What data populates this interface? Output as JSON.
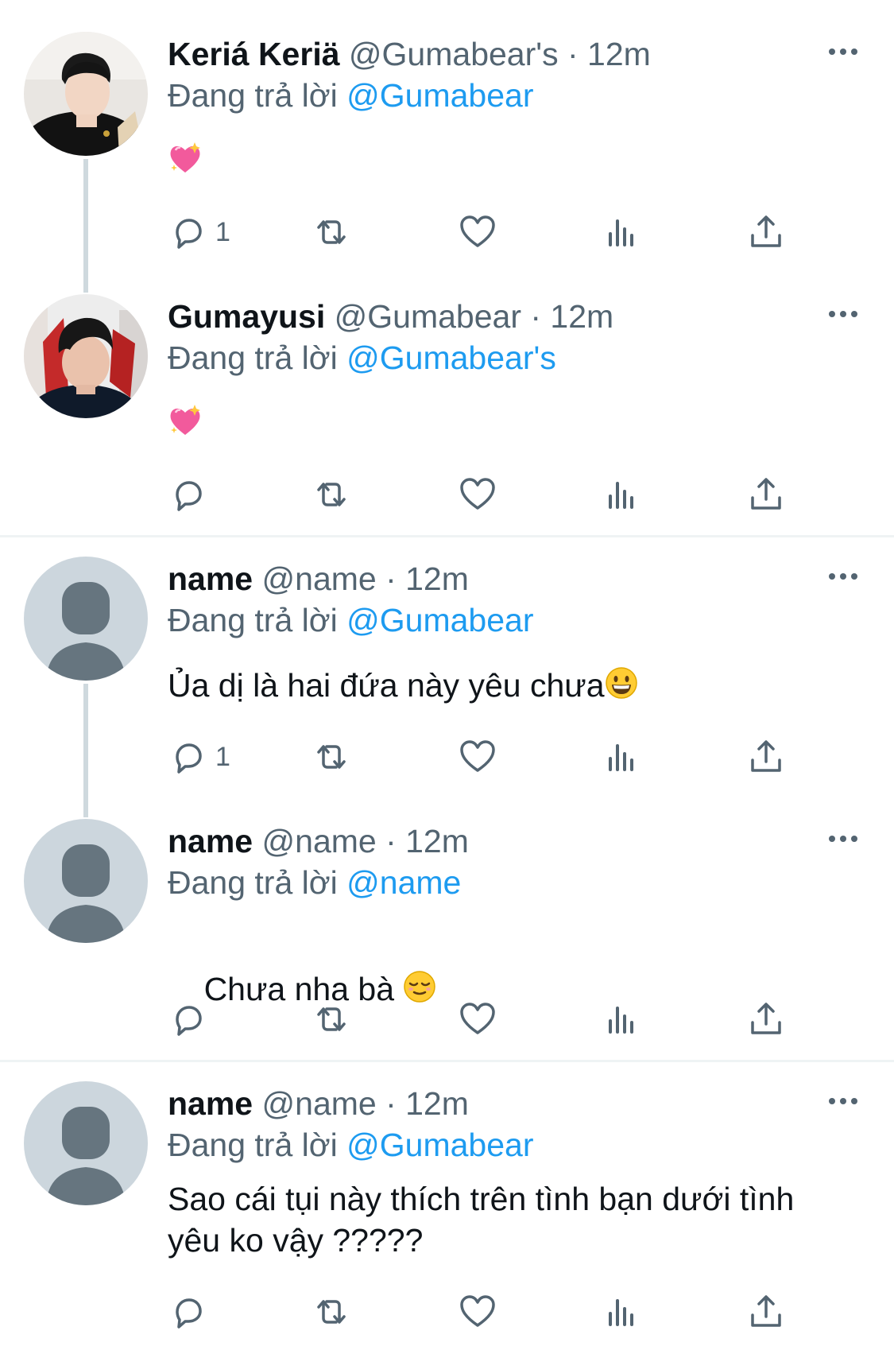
{
  "tweets": [
    {
      "display_name": "Keriá Keriä",
      "meta": "@Gumabear's · 12m",
      "reply_prefix": "Đang trả lời",
      "reply_mention": "@Gumabear",
      "text": "",
      "emoji": "sparkling-heart",
      "reply_count": "1"
    },
    {
      "display_name": "Gumayusi",
      "meta": "@Gumabear · 12m",
      "reply_prefix": "Đang trả lời",
      "reply_mention": "@Gumabear's",
      "text": "",
      "emoji": "sparkling-heart",
      "reply_count": ""
    },
    {
      "display_name": "name",
      "meta": "@name · 12m",
      "reply_prefix": "Đang trả lời",
      "reply_mention": "@Gumabear",
      "text": "Ủa dị là hai đứa này yêu chưa",
      "emoji": "grinning-face",
      "reply_count": "1"
    },
    {
      "display_name": "name",
      "meta": "@name · 12m",
      "reply_prefix": "Đang trả lời",
      "reply_mention": "@name",
      "text": "Chưa nha bà ",
      "emoji": "relieved-face",
      "reply_count": ""
    },
    {
      "display_name": "name",
      "meta": "@name · 12m",
      "reply_prefix": "Đang trả lời",
      "reply_mention": "@Gumabear",
      "text_line1": "Sao cái tụi này thích trên tình bạn dưới tình",
      "text_line2": "yêu ko vậy ?????",
      "reply_count": ""
    }
  ],
  "colors": {
    "text": "#0f1419",
    "secondary": "#536471",
    "link": "#1d9bf0",
    "thread_line": "#cfd9de",
    "divider": "#eff3f4"
  }
}
